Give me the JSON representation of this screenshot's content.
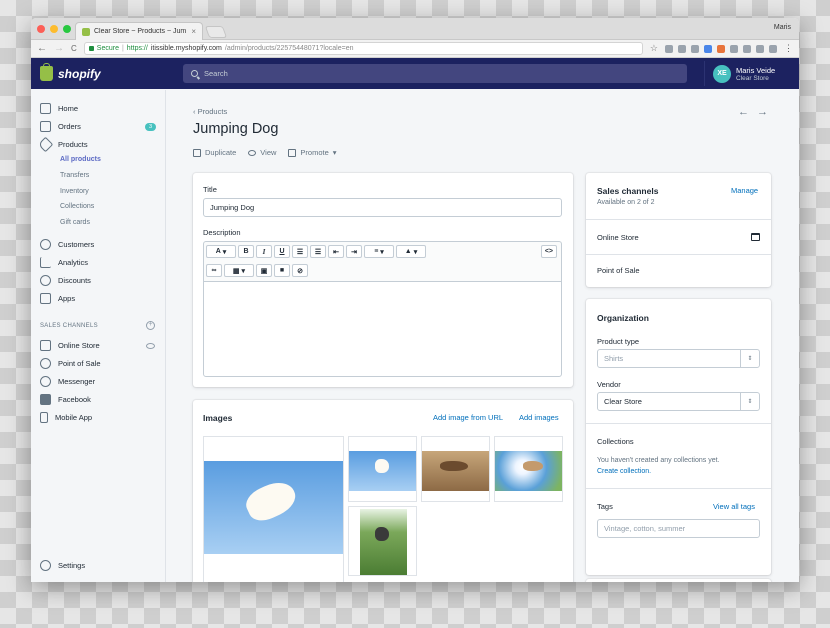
{
  "browser": {
    "tab_title": "Clear Store ~ Products ~ Jum",
    "tab_close": "×",
    "profile": "Maris",
    "secure_label": "Secure",
    "url_proto": "https://",
    "url_host": "itissible.myshopify.com",
    "url_path": "/admin/products/22575448071?locale=en",
    "nav": {
      "back": "←",
      "forward": "→",
      "reload": "C"
    }
  },
  "header": {
    "logo": "shopify",
    "search_placeholder": "Search",
    "user": {
      "initials": "XE",
      "name": "Maris Veide",
      "store": "Clear Store"
    }
  },
  "sidebar": {
    "items": [
      {
        "label": "Home",
        "icon": "home-icon"
      },
      {
        "label": "Orders",
        "icon": "orders-icon",
        "badge": "3"
      },
      {
        "label": "Products",
        "icon": "tag-icon"
      }
    ],
    "sub_items": [
      "All products",
      "Transfers",
      "Inventory",
      "Collections",
      "Gift cards"
    ],
    "items2": [
      {
        "label": "Customers",
        "icon": "person-icon"
      },
      {
        "label": "Analytics",
        "icon": "bar-chart-icon"
      },
      {
        "label": "Discounts",
        "icon": "discount-icon"
      },
      {
        "label": "Apps",
        "icon": "apps-icon"
      }
    ],
    "channels_label": "SALES CHANNELS",
    "channels": [
      {
        "label": "Online Store",
        "icon": "store-icon"
      },
      {
        "label": "Point of Sale",
        "icon": "pin-icon"
      },
      {
        "label": "Messenger",
        "icon": "messenger-icon"
      },
      {
        "label": "Facebook",
        "icon": "facebook-icon"
      },
      {
        "label": "Mobile App",
        "icon": "mobile-icon"
      }
    ],
    "settings": "Settings"
  },
  "page": {
    "breadcrumb": "Products",
    "title": "Jumping Dog",
    "actions": {
      "duplicate": "Duplicate",
      "view": "View",
      "promote": "Promote"
    }
  },
  "product_form": {
    "title_label": "Title",
    "title_value": "Jumping Dog",
    "description_label": "Description",
    "toolbar": {
      "font": "A",
      "bold": "B",
      "italic": "I",
      "underline": "U",
      "code": "<>"
    }
  },
  "images": {
    "title": "Images",
    "add_from_url": "Add image from URL",
    "add_images": "Add images"
  },
  "sales_channels": {
    "title": "Sales channels",
    "manage": "Manage",
    "availability": "Available on 2 of 2",
    "channels": [
      "Online Store",
      "Point of Sale"
    ]
  },
  "organization": {
    "title": "Organization",
    "product_type_label": "Product type",
    "product_type_placeholder": "Shirts",
    "vendor_label": "Vendor",
    "vendor_value": "Clear Store",
    "collections_label": "Collections",
    "collections_note": "You haven't created any collections yet.",
    "create_collection": "Create collection.",
    "tags_label": "Tags",
    "view_all_tags": "View all tags",
    "tags_placeholder": "Vintage, cotton, summer"
  }
}
